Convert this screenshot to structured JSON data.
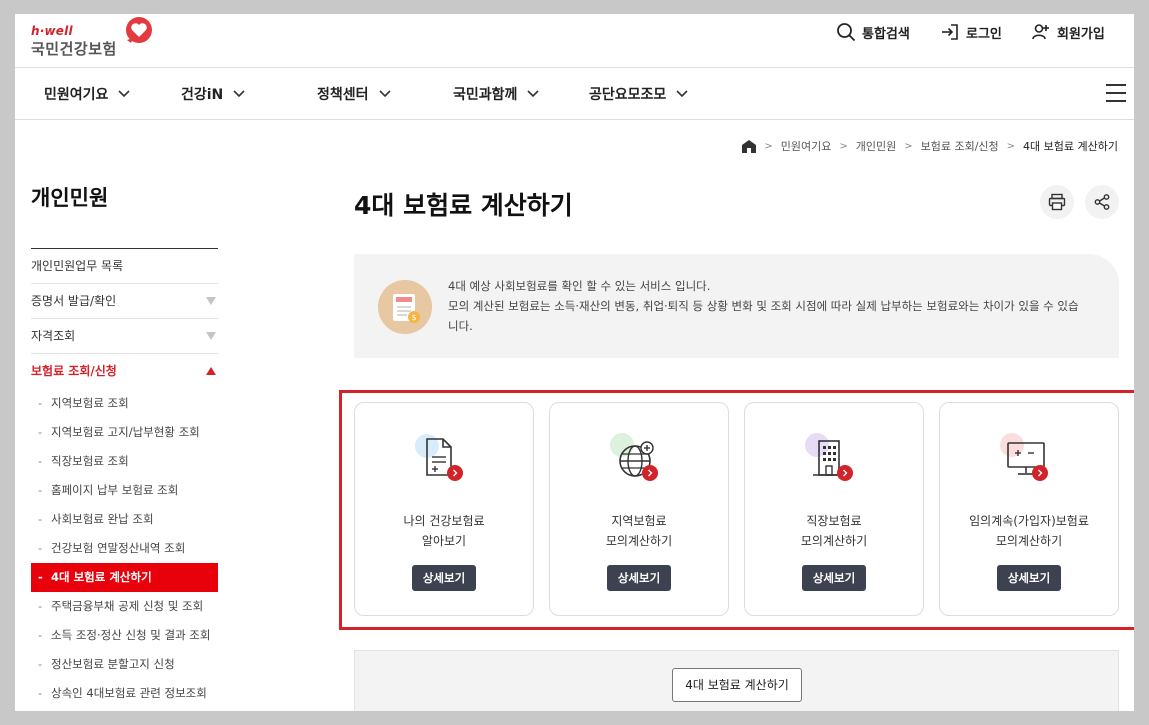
{
  "brand": {
    "small": "h·well",
    "name": "국민건강보험"
  },
  "utility": {
    "search": "통합검색",
    "login": "로그인",
    "signup": "회원가입"
  },
  "gnb": [
    "민원여기요",
    "건강iN",
    "정책센터",
    "국민과함께",
    "공단요모조모"
  ],
  "breadcrumb": [
    "민원여기요",
    "개인민원",
    "보험료 조회/신청",
    "4대 보험료 계산하기"
  ],
  "sidebar": {
    "title": "개인민원",
    "items": [
      {
        "label": "개인민원업무 목록"
      },
      {
        "label": "증명서 발급/확인"
      },
      {
        "label": "자격조회"
      },
      {
        "label": "보험료 조회/신청"
      }
    ],
    "sub_items": [
      "지역보험료 조회",
      "지역보험료 고지/납부현황 조회",
      "직장보험료 조회",
      "홈페이지 납부 보험료 조회",
      "사회보험료 완납 조회",
      "건강보험 연말정산내역 조회",
      "4대 보험료 계산하기",
      "주택금융부채 공제 신청 및 조회",
      "소득 조정·정산 신청 및 결과 조회",
      "정산보험료 분할고지 신청",
      "상속인 4대보험료 관련 정보조회"
    ]
  },
  "main": {
    "title": "4대 보험료 계산하기",
    "info_line1": "4대 예상 사회보험료를 확인 할 수 있는 서비스 입니다.",
    "info_line2": "모의 계산된 보험료는 소득·재산의 변동, 취업·퇴직 등 상황 변화 및 조회 시점에 따라 실제 납부하는 보험료와는 차이가 있을 수 있습니다.",
    "cards": [
      {
        "line1": "나의 건강보험료",
        "line2": "알아보기",
        "button": "상세보기",
        "icon": "document-plus-icon"
      },
      {
        "line1": "지역보험료",
        "line2": "모의계산하기",
        "button": "상세보기",
        "icon": "globe-plus-icon"
      },
      {
        "line1": "직장보험료",
        "line2": "모의계산하기",
        "button": "상세보기",
        "icon": "building-icon"
      },
      {
        "line1": "임의계속(가입자)보험료",
        "line2": "모의계산하기",
        "button": "상세보기",
        "icon": "monitor-calc-icon"
      }
    ],
    "bottom_button": "4대 보험료 계산하기"
  },
  "colors": {
    "brand_red": "#d3232a",
    "active_red": "#e8000b",
    "button_dark": "#3c4250"
  }
}
